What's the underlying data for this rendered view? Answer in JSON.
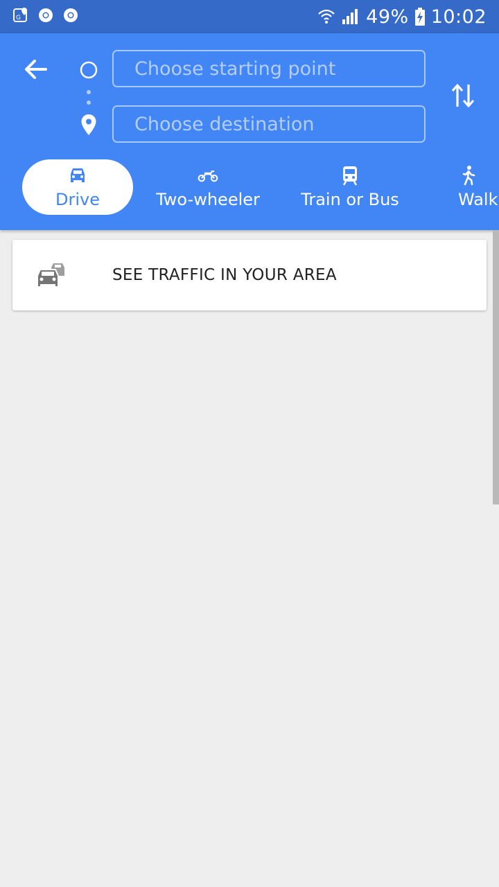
{
  "status_bar": {
    "battery": "49%",
    "time": "10:02"
  },
  "search": {
    "start_placeholder": "Choose starting point",
    "destination_placeholder": "Choose destination"
  },
  "modes": [
    {
      "label": "Drive",
      "icon": "car-icon",
      "selected": true
    },
    {
      "label": "Two-wheeler",
      "icon": "motorcycle-icon",
      "selected": false
    },
    {
      "label": "Train or Bus",
      "icon": "train-icon",
      "selected": false
    },
    {
      "label": "Walk",
      "icon": "walk-icon",
      "selected": false
    }
  ],
  "traffic_card": {
    "label": "SEE TRAFFIC IN YOUR AREA",
    "icon": "traffic-cars-icon"
  },
  "colors": {
    "header": "#4285f4",
    "status_bar": "#356ac9",
    "background": "#eeeeee"
  }
}
